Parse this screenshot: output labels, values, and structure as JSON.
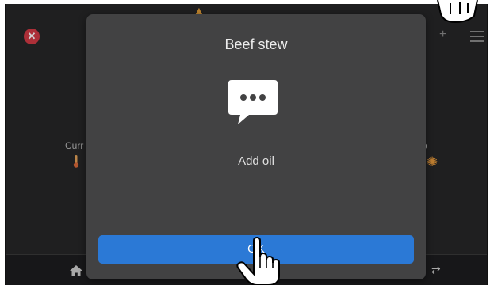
{
  "background": {
    "left_label": "Curr",
    "right_label": "tep",
    "colors": {
      "close": "#d23a45",
      "fan": "#e89a3b",
      "screen": "#262628"
    },
    "icons": [
      "close-icon",
      "warning-icon",
      "plus-icon",
      "menu-icon",
      "thermometer-icon",
      "fan-icon",
      "home-icon",
      "translate-icon"
    ]
  },
  "dialog": {
    "title": "Beef stew",
    "icon": "chat-bubble-icon",
    "message": "Add oil",
    "ok_label": "OK",
    "colors": {
      "panel": "#424243",
      "button": "#2b79d6"
    }
  },
  "overlays": {
    "cursor_icons": [
      "hand-pointer-icon",
      "hand-pointer-icon"
    ]
  }
}
